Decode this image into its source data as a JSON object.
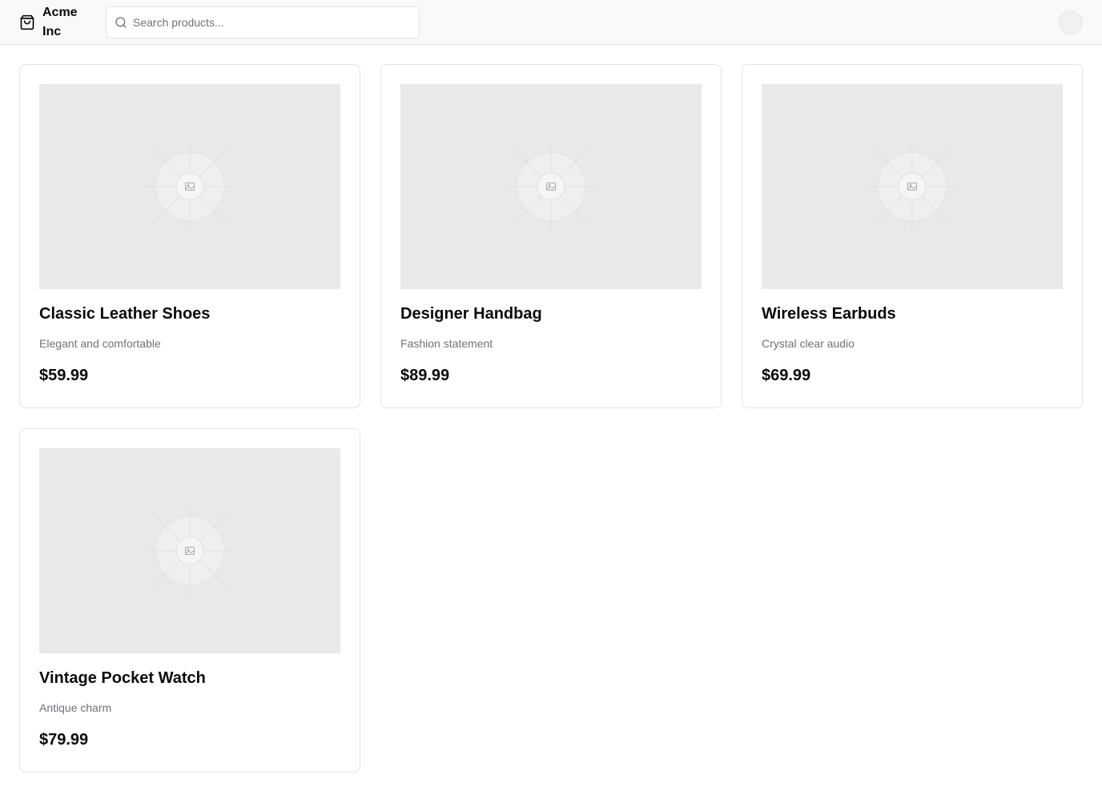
{
  "header": {
    "brand_name": "Acme Inc",
    "brand_icon": "package-icon",
    "search": {
      "placeholder": "Search products...",
      "value": "",
      "icon": "search-icon"
    },
    "avatar_icon": "avatar"
  },
  "products": [
    {
      "title": "Classic Leather Shoes",
      "description": "Elegant and comfortable",
      "price": "$59.99",
      "image_icon": "image-placeholder-icon"
    },
    {
      "title": "Designer Handbag",
      "description": "Fashion statement",
      "price": "$89.99",
      "image_icon": "image-placeholder-icon"
    },
    {
      "title": "Wireless Earbuds",
      "description": "Crystal clear audio",
      "price": "$69.99",
      "image_icon": "image-placeholder-icon"
    },
    {
      "title": "Vintage Pocket Watch",
      "description": "Antique charm",
      "price": "$79.99",
      "image_icon": "image-placeholder-icon"
    }
  ]
}
